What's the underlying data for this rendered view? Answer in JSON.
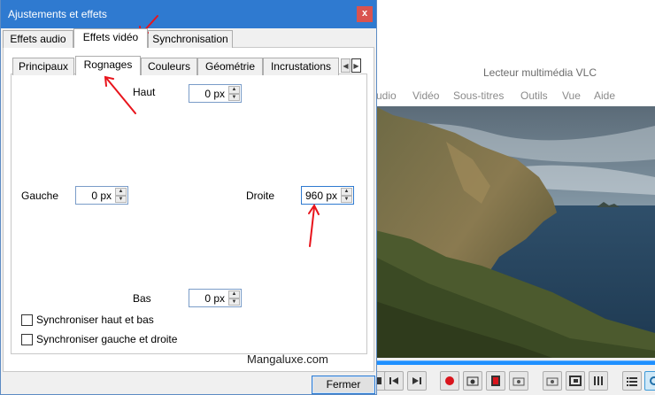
{
  "dialog": {
    "title": "Ajustements et effets",
    "close": "x",
    "main_tabs": [
      {
        "label": "Effets audio"
      },
      {
        "label": "Effets vidéo"
      },
      {
        "label": "Synchronisation"
      }
    ],
    "sub_tabs": [
      {
        "label": "Principaux"
      },
      {
        "label": "Rognages"
      },
      {
        "label": "Couleurs"
      },
      {
        "label": "Géométrie"
      },
      {
        "label": "Incrustations"
      }
    ],
    "crop": {
      "top_label": "Haut",
      "top_value": "0 px",
      "left_label": "Gauche",
      "left_value": "0 px",
      "right_label": "Droite",
      "right_value": "960 px",
      "bottom_label": "Bas",
      "bottom_value": "0 px"
    },
    "checkboxes": [
      {
        "label": "Synchroniser haut et bas",
        "checked": false
      },
      {
        "label": "Synchroniser gauche et droite",
        "checked": false
      }
    ],
    "close_button": "Fermer",
    "watermark": "Mangaluxe.com"
  },
  "vlc": {
    "title": "Lecteur multimédia VLC",
    "menu": [
      "udio",
      "Vidéo",
      "Sous-titres",
      "Outils",
      "Vue",
      "Aide"
    ],
    "controls": [
      "stop-icon",
      "prev-icon",
      "next-icon",
      "record-icon",
      "snapshot-icon",
      "frame-icon",
      "camera-icon",
      "photo-icon",
      "fullscreen-icon",
      "equalizer-icon",
      "playlist-icon",
      "loop-icon"
    ]
  },
  "colors": {
    "title_bar": "#2f7ad0",
    "close_red": "#d9534f",
    "annotation_red": "#e8141c",
    "seek_blue": "#1e90ff"
  }
}
